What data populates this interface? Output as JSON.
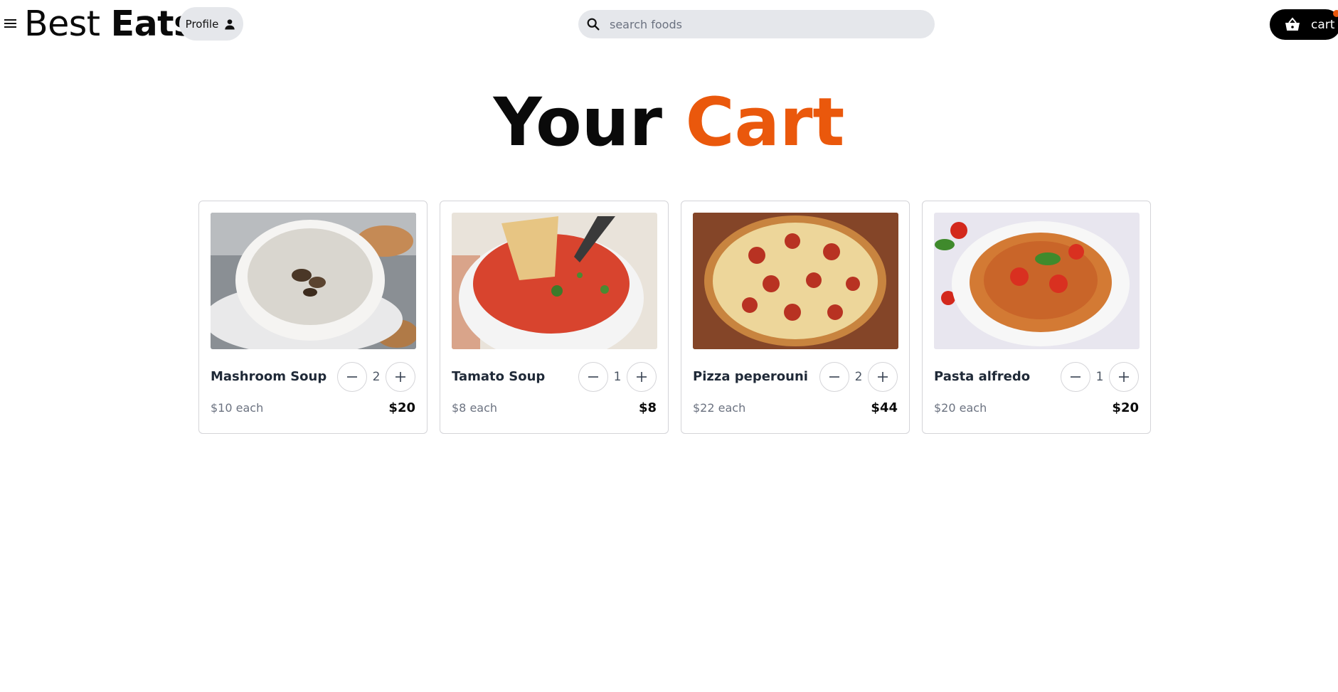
{
  "header": {
    "brand_light": "Best",
    "brand_bold": "Eats",
    "profile_label": "Profile",
    "search_placeholder": "search foods",
    "search_value": "",
    "cart_label": "cart"
  },
  "page": {
    "title_main": "Your",
    "title_accent": "Cart"
  },
  "colors": {
    "accent": "#ea580c",
    "cart_button": "#000000",
    "pill_background": "#e5e7eb"
  },
  "icons": {
    "menu": "menu-icon",
    "profile": "person-icon",
    "search": "search-icon",
    "cart": "basket-icon",
    "decrease": "minus-icon",
    "increase": "plus-icon"
  },
  "cart_items": [
    {
      "name": "Mashroom Soup",
      "quantity": "2",
      "unit_price": "$10 each",
      "total": "$20",
      "image": "mushroom-soup-photo"
    },
    {
      "name": "Tamato Soup",
      "quantity": "1",
      "unit_price": "$8 each",
      "total": "$8",
      "image": "tomato-soup-photo"
    },
    {
      "name": "Pizza peperouni",
      "quantity": "2",
      "unit_price": "$22 each",
      "total": "$44",
      "image": "pepperoni-pizza-photo"
    },
    {
      "name": "Pasta alfredo",
      "quantity": "1",
      "unit_price": "$20 each",
      "total": "$20",
      "image": "pasta-photo"
    }
  ]
}
